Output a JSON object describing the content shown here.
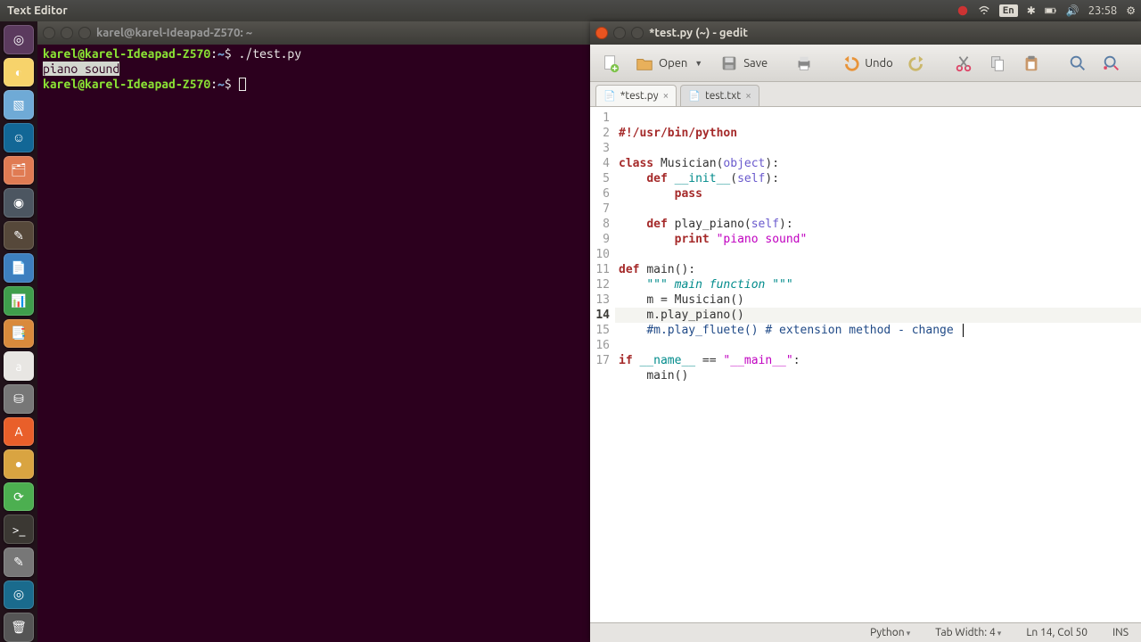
{
  "menubar": {
    "app_title": "Text Editor",
    "keyboard_indicator": "En",
    "time": "23:58"
  },
  "launcher_tiles": [
    {
      "name": "dash",
      "color": "#5b3a5e",
      "glyph": "◎"
    },
    {
      "name": "chrome",
      "color": "#f7d36b",
      "glyph": "◐"
    },
    {
      "name": "cube",
      "color": "#6faad6",
      "glyph": "▧"
    },
    {
      "name": "mozilla",
      "color": "#126796",
      "glyph": "☺"
    },
    {
      "name": "files",
      "color": "#e07b53",
      "glyph": "🗂"
    },
    {
      "name": "steam",
      "color": "#4c5661",
      "glyph": "◉"
    },
    {
      "name": "gimp",
      "color": "#56483a",
      "glyph": "✎"
    },
    {
      "name": "writer",
      "color": "#3d7fbf",
      "glyph": "📄"
    },
    {
      "name": "calc",
      "color": "#3f9e4c",
      "glyph": "📊"
    },
    {
      "name": "impress",
      "color": "#d98a3c",
      "glyph": "📑"
    },
    {
      "name": "amazon",
      "color": "#e8e6e3",
      "glyph": "a"
    },
    {
      "name": "disk",
      "color": "#777",
      "glyph": "⛁"
    },
    {
      "name": "software",
      "color": "#e95f2a",
      "glyph": "A"
    },
    {
      "name": "yellow",
      "color": "#d9a441",
      "glyph": "●"
    },
    {
      "name": "updater",
      "color": "#4caf50",
      "glyph": "⟳"
    },
    {
      "name": "terminal",
      "color": "#3b3833",
      "glyph": ">_"
    },
    {
      "name": "editor",
      "color": "#777",
      "glyph": "✎"
    },
    {
      "name": "world",
      "color": "#1a6b8d",
      "glyph": "◎"
    },
    {
      "name": "trash",
      "color": "#555",
      "glyph": "🗑"
    }
  ],
  "terminal": {
    "title": "karel@karel-Ideapad-Z570: ~",
    "user": "karel@karel-Ideapad-Z570",
    "path": "~",
    "cmd1": "./test.py",
    "output": "piano sound"
  },
  "gedit": {
    "title": "*test.py (~) - gedit",
    "toolbar": {
      "open": "Open",
      "save": "Save",
      "undo": "Undo"
    },
    "tabs": [
      {
        "label": "*test.py",
        "active": true
      },
      {
        "label": "test.txt",
        "active": false
      }
    ],
    "code": {
      "l1_shebang": "#!/usr/bin/python",
      "l3_class": "class",
      "l3_name": "Musician",
      "l3_obj": "object",
      "l4_def": "def",
      "l4_init": "__init__",
      "l4_self": "self",
      "l5_pass": "pass",
      "l7_def": "def",
      "l7_name": "play_piano",
      "l7_self": "self",
      "l8_print": "print",
      "l8_str": "\"piano sound\"",
      "l10_def": "def",
      "l10_name": "main",
      "l11_doc": "\"\"\" main function \"\"\"",
      "l12": "m = Musician()",
      "l13": "m.play_piano()",
      "l14_com": "#m.play_fluete() # extension method - change ",
      "l16_if": "if",
      "l16_name": "__name__",
      "l16_eq": " == ",
      "l16_main": "\"__main__\"",
      "l17": "main()"
    },
    "statusbar": {
      "lang": "Python",
      "tabwidth": "Tab Width: 4",
      "pos": "Ln 14, Col 50",
      "ins": "INS"
    }
  }
}
